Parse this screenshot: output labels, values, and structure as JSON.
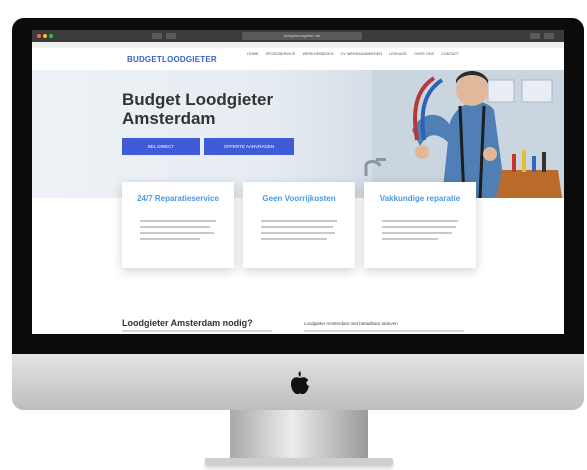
{
  "browser": {
    "url": "budgetloodgieter.net"
  },
  "site": {
    "logo": "BUDGETLOODGIETER",
    "nav": [
      "HOME",
      "SPOEDSERVICE",
      "WERKGEBIEDEN",
      "CV WERKZAAMHEDEN",
      "LEKKAGE",
      "OVER ONS",
      "CONTACT"
    ],
    "hero_title": "Budget Loodgieter Amsterdam",
    "buttons": [
      "BEL DIRECT",
      "OFFERTE AANVRAGEN"
    ],
    "cards": [
      {
        "title": "24/7 Reparatieservice"
      },
      {
        "title": "Geen Voorrijkosten"
      },
      {
        "title": "Vakkundige reparatie"
      }
    ],
    "section_title": "Loodgieter Amsterdam nodig?",
    "section_sub": "Loodgieter Amsterdam met betaalbare tarieven"
  },
  "colors": {
    "accent": "#3f5bd8",
    "card_title": "#4a9ae0"
  }
}
